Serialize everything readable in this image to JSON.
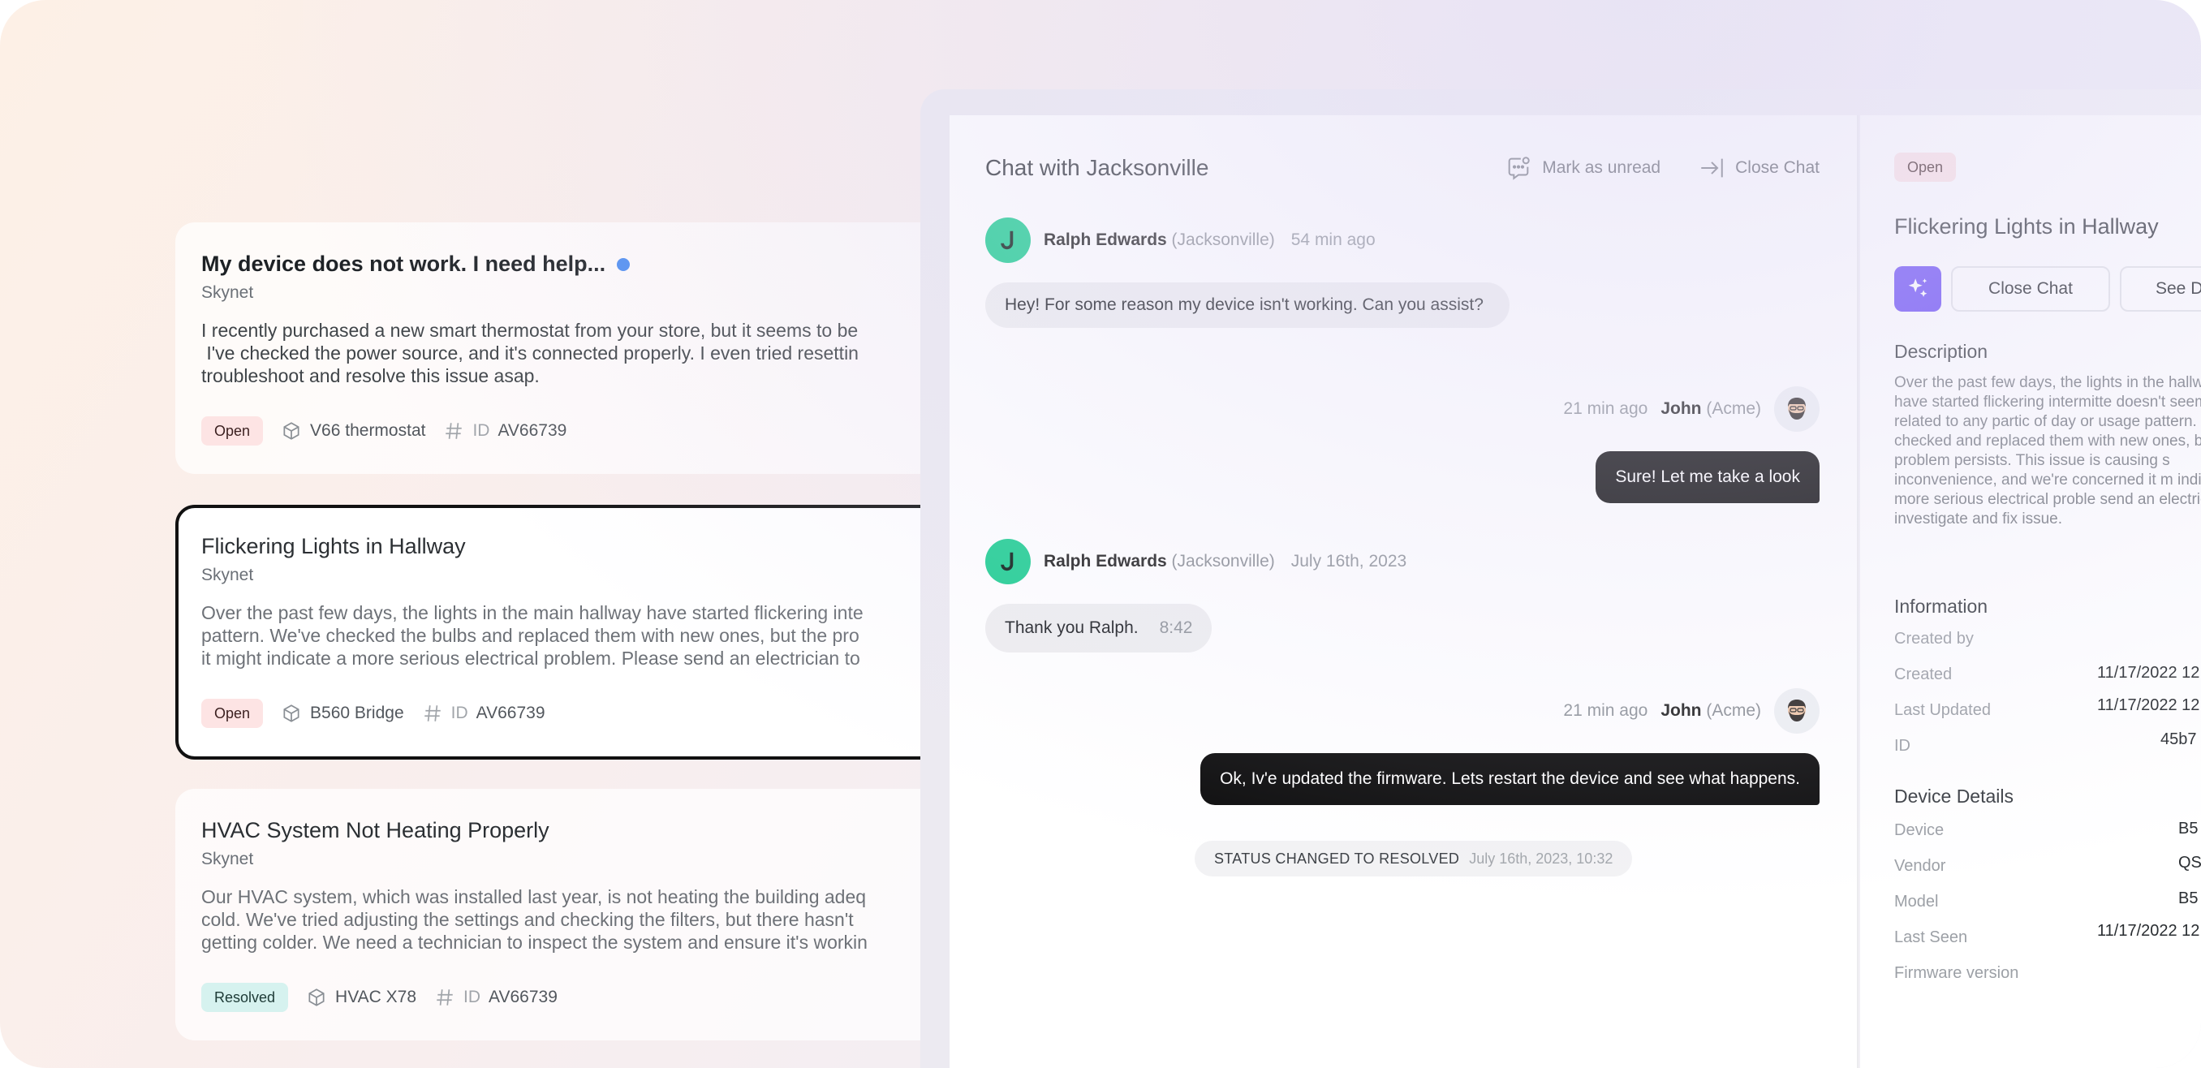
{
  "tickets": [
    {
      "title": "My device does not work. I need help...",
      "org": "Skynet",
      "description": "I recently purchased a new smart thermostat from your store, but it seems to be\n I've checked the power source, and it's connected properly. I even tried resettin\ntroubleshoot and resolve this issue asap.",
      "status": "Open",
      "device": "V66 thermostat",
      "id_label": "ID",
      "id": "AV66739"
    },
    {
      "title": "Flickering Lights in Hallway",
      "org": "Skynet",
      "description": "Over the past few days, the lights in the main hallway have started flickering inte\npattern. We've checked the bulbs and replaced them with new ones, but the pro\nit might indicate a more serious electrical problem. Please send an electrician to",
      "status": "Open",
      "device": "B560 Bridge",
      "id_label": "ID",
      "id": "AV66739"
    },
    {
      "title": "HVAC System Not Heating Properly",
      "org": "Skynet",
      "description": "Our HVAC system, which was installed last year, is not heating the building adeq\ncold. We've tried adjusting the settings and checking the filters, but there hasn't\ngetting colder. We need a technician to inspect the system and ensure it's workin",
      "status": "Resolved",
      "device": "HVAC X78",
      "id_label": "ID",
      "id": "AV66739"
    }
  ],
  "chat": {
    "title": "Chat with Jacksonville",
    "mark_unread": "Mark as unread",
    "close_chat": "Close Chat",
    "messages": [
      {
        "sender": "Ralph Edwards",
        "org": "(Jacksonville)",
        "time": "54 min ago",
        "text": "Hey! For some reason my device isn't working.  Can you assist?"
      },
      {
        "sender": "John",
        "org": "(Acme)",
        "time": "21 min ago",
        "text": "Sure! Let me take a look"
      },
      {
        "sender": "Ralph Edwards",
        "org": "(Jacksonville)",
        "time": "July 16th, 2023",
        "text": "Thank you Ralph.",
        "inline_time": "8:42"
      },
      {
        "sender": "John",
        "org": "(Acme)",
        "time": "21 min ago",
        "text": "Ok, Iv'e updated the firmware. Lets restart the device and see what happens."
      }
    ],
    "status_change": {
      "text": "STATUS CHANGED TO RESOLVED",
      "date": "July 16th, 2023, 10:32"
    }
  },
  "detail": {
    "status": "Open",
    "title": "Flickering Lights in Hallway",
    "close_chat": "Close Chat",
    "see_details": "See De",
    "description_heading": "Description",
    "description": "Over the past few days, the lights in the hallway have started flickering intermitte doesn't seem to be related to any partic of day or usage pattern. We've checked and replaced them with new ones, but t problem persists. This issue is causing s inconvenience, and we're concerned it m indicate a more serious electrical proble send an electrician to investigate and fix issue.",
    "information_heading": "Information",
    "created_by_label": "Created by",
    "created_label": "Created",
    "created_value": "11/17/2022 12",
    "updated_label": "Last Updated",
    "updated_value": "11/17/2022 12",
    "id_label": "ID",
    "id_value": "45b7",
    "device_heading": "Device Details",
    "device_label": "Device",
    "device_value": "B5",
    "vendor_label": "Vendor",
    "vendor_value": "QS",
    "model_label": "Model",
    "model_value": "B5",
    "last_seen_label": "Last Seen",
    "last_seen_value": "11/17/2022 12",
    "firmware_label": "Firmware version"
  },
  "colors": {
    "accent_ai": "#6a4cf5",
    "avatar_green": "#1fce92",
    "open_pill": "#fde4e4",
    "resolved_pill": "#d6f2ef",
    "unread_dot": "#4d8df0"
  }
}
